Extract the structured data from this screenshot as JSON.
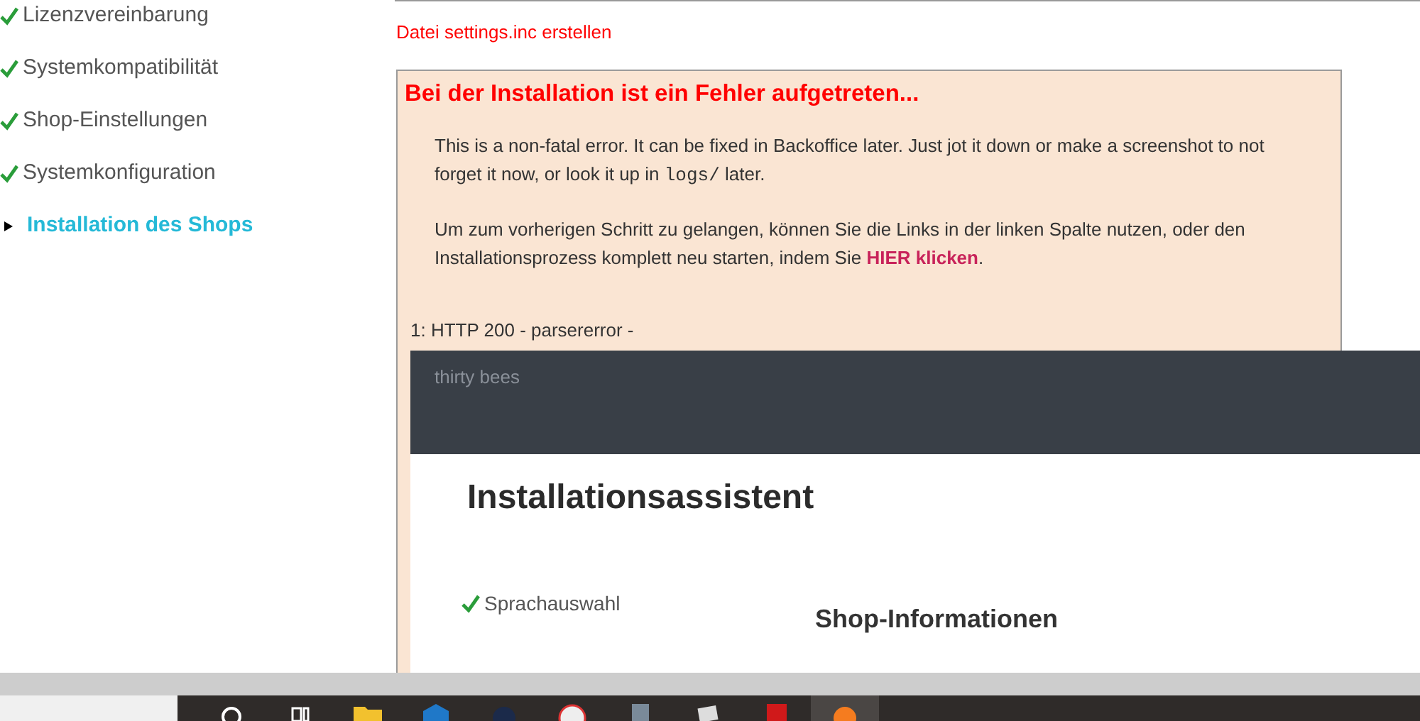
{
  "sidebar": {
    "items": [
      {
        "label": "Lizenzvereinbarung",
        "kind": "completed"
      },
      {
        "label": "Systemkompatibilität",
        "kind": "completed"
      },
      {
        "label": "Shop-Einstellungen",
        "kind": "completed"
      },
      {
        "label": "Systemkonfiguration",
        "kind": "completed"
      },
      {
        "label": "Installation des Shops",
        "kind": "current"
      }
    ]
  },
  "main": {
    "step_message": "Datei settings.inc erstellen",
    "error": {
      "title": "Bei der Installation ist ein Fehler aufgetreten...",
      "note_parts": [
        "This is a non-fatal error. It can be fixed in Backoffice later. Just jot it down or make a screenshot to not forget it now, or look it up in ",
        "logs/",
        " later."
      ],
      "restart_text": "Um zum vorherigen Schritt zu gelangen, können Sie die Links in der linken Spalte nutzen, oder den Installationsprozess komplett neu starten, indem Sie ",
      "restart_link": "HIER klicken",
      "restart_end": ".",
      "response_line": "1: HTTP 200 - parsererror -",
      "embedded_page": {
        "header_brand": "thirty bees",
        "title": "Installationsassistent",
        "steps": [
          {
            "label": "Sprachauswahl",
            "kind": "completed"
          }
        ],
        "section_title": "Shop-Informationen"
      }
    }
  }
}
